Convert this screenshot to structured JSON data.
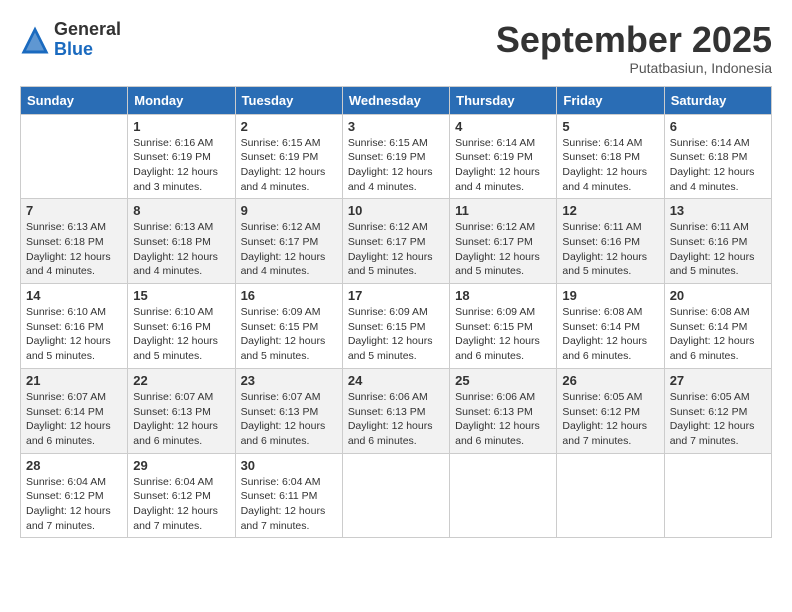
{
  "header": {
    "logo_general": "General",
    "logo_blue": "Blue",
    "month_title": "September 2025",
    "subtitle": "Putatbasiun, Indonesia"
  },
  "days_of_week": [
    "Sunday",
    "Monday",
    "Tuesday",
    "Wednesday",
    "Thursday",
    "Friday",
    "Saturday"
  ],
  "weeks": [
    [
      {
        "day": "",
        "info": ""
      },
      {
        "day": "1",
        "info": "Sunrise: 6:16 AM\nSunset: 6:19 PM\nDaylight: 12 hours\nand 3 minutes."
      },
      {
        "day": "2",
        "info": "Sunrise: 6:15 AM\nSunset: 6:19 PM\nDaylight: 12 hours\nand 4 minutes."
      },
      {
        "day": "3",
        "info": "Sunrise: 6:15 AM\nSunset: 6:19 PM\nDaylight: 12 hours\nand 4 minutes."
      },
      {
        "day": "4",
        "info": "Sunrise: 6:14 AM\nSunset: 6:19 PM\nDaylight: 12 hours\nand 4 minutes."
      },
      {
        "day": "5",
        "info": "Sunrise: 6:14 AM\nSunset: 6:18 PM\nDaylight: 12 hours\nand 4 minutes."
      },
      {
        "day": "6",
        "info": "Sunrise: 6:14 AM\nSunset: 6:18 PM\nDaylight: 12 hours\nand 4 minutes."
      }
    ],
    [
      {
        "day": "7",
        "info": "Sunrise: 6:13 AM\nSunset: 6:18 PM\nDaylight: 12 hours\nand 4 minutes."
      },
      {
        "day": "8",
        "info": "Sunrise: 6:13 AM\nSunset: 6:18 PM\nDaylight: 12 hours\nand 4 minutes."
      },
      {
        "day": "9",
        "info": "Sunrise: 6:12 AM\nSunset: 6:17 PM\nDaylight: 12 hours\nand 4 minutes."
      },
      {
        "day": "10",
        "info": "Sunrise: 6:12 AM\nSunset: 6:17 PM\nDaylight: 12 hours\nand 5 minutes."
      },
      {
        "day": "11",
        "info": "Sunrise: 6:12 AM\nSunset: 6:17 PM\nDaylight: 12 hours\nand 5 minutes."
      },
      {
        "day": "12",
        "info": "Sunrise: 6:11 AM\nSunset: 6:16 PM\nDaylight: 12 hours\nand 5 minutes."
      },
      {
        "day": "13",
        "info": "Sunrise: 6:11 AM\nSunset: 6:16 PM\nDaylight: 12 hours\nand 5 minutes."
      }
    ],
    [
      {
        "day": "14",
        "info": "Sunrise: 6:10 AM\nSunset: 6:16 PM\nDaylight: 12 hours\nand 5 minutes."
      },
      {
        "day": "15",
        "info": "Sunrise: 6:10 AM\nSunset: 6:16 PM\nDaylight: 12 hours\nand 5 minutes."
      },
      {
        "day": "16",
        "info": "Sunrise: 6:09 AM\nSunset: 6:15 PM\nDaylight: 12 hours\nand 5 minutes."
      },
      {
        "day": "17",
        "info": "Sunrise: 6:09 AM\nSunset: 6:15 PM\nDaylight: 12 hours\nand 5 minutes."
      },
      {
        "day": "18",
        "info": "Sunrise: 6:09 AM\nSunset: 6:15 PM\nDaylight: 12 hours\nand 6 minutes."
      },
      {
        "day": "19",
        "info": "Sunrise: 6:08 AM\nSunset: 6:14 PM\nDaylight: 12 hours\nand 6 minutes."
      },
      {
        "day": "20",
        "info": "Sunrise: 6:08 AM\nSunset: 6:14 PM\nDaylight: 12 hours\nand 6 minutes."
      }
    ],
    [
      {
        "day": "21",
        "info": "Sunrise: 6:07 AM\nSunset: 6:14 PM\nDaylight: 12 hours\nand 6 minutes."
      },
      {
        "day": "22",
        "info": "Sunrise: 6:07 AM\nSunset: 6:13 PM\nDaylight: 12 hours\nand 6 minutes."
      },
      {
        "day": "23",
        "info": "Sunrise: 6:07 AM\nSunset: 6:13 PM\nDaylight: 12 hours\nand 6 minutes."
      },
      {
        "day": "24",
        "info": "Sunrise: 6:06 AM\nSunset: 6:13 PM\nDaylight: 12 hours\nand 6 minutes."
      },
      {
        "day": "25",
        "info": "Sunrise: 6:06 AM\nSunset: 6:13 PM\nDaylight: 12 hours\nand 6 minutes."
      },
      {
        "day": "26",
        "info": "Sunrise: 6:05 AM\nSunset: 6:12 PM\nDaylight: 12 hours\nand 7 minutes."
      },
      {
        "day": "27",
        "info": "Sunrise: 6:05 AM\nSunset: 6:12 PM\nDaylight: 12 hours\nand 7 minutes."
      }
    ],
    [
      {
        "day": "28",
        "info": "Sunrise: 6:04 AM\nSunset: 6:12 PM\nDaylight: 12 hours\nand 7 minutes."
      },
      {
        "day": "29",
        "info": "Sunrise: 6:04 AM\nSunset: 6:12 PM\nDaylight: 12 hours\nand 7 minutes."
      },
      {
        "day": "30",
        "info": "Sunrise: 6:04 AM\nSunset: 6:11 PM\nDaylight: 12 hours\nand 7 minutes."
      },
      {
        "day": "",
        "info": ""
      },
      {
        "day": "",
        "info": ""
      },
      {
        "day": "",
        "info": ""
      },
      {
        "day": "",
        "info": ""
      }
    ]
  ]
}
